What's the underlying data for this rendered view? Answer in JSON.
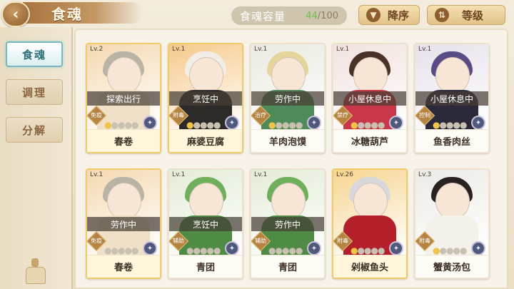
{
  "header": {
    "back_icon": "back-arrow-icon",
    "title": "食魂",
    "capacity_label": "食魂容量",
    "capacity_current": "44",
    "capacity_max": "/100",
    "sort_order_label": "降序",
    "sort_field_label": "等级"
  },
  "sidebar": {
    "tabs": [
      {
        "label": "食魂",
        "active": true
      },
      {
        "label": "调理",
        "active": false
      },
      {
        "label": "分解",
        "active": false
      }
    ]
  },
  "cards": [
    {
      "level": "Lv.2",
      "status": "探索出行",
      "role": "免疫",
      "name": "春卷",
      "stars": 1,
      "max_stars": 5,
      "rarity": "gold",
      "hair": "#b9b3a6",
      "outfit": "#f0e0c8",
      "bg": "#f5d9b2"
    },
    {
      "level": "Lv.1",
      "status": "烹饪中",
      "role": "附毒",
      "name": "麻婆豆腐",
      "stars": 1,
      "max_stars": 5,
      "rarity": "gold",
      "hair": "#f2ede6",
      "outfit": "#2d2a2a",
      "bg": "#f6c98a"
    },
    {
      "level": "Lv.1",
      "status": "劳作中",
      "role": "治疗",
      "name": "羊肉泡馍",
      "stars": 1,
      "max_stars": 5,
      "rarity": "normal",
      "hair": "#e6d59a",
      "outfit": "#4f8a5b",
      "bg": "#eaeae2"
    },
    {
      "level": "Lv.1",
      "status": "小屋休息中",
      "role": "禁疗",
      "name": "冰糖葫芦",
      "stars": 1,
      "max_stars": 5,
      "rarity": "normal",
      "hair": "#4a3228",
      "outfit": "#c9384a",
      "bg": "#f1e2df"
    },
    {
      "level": "Lv.1",
      "status": "小屋休息中",
      "role": "控制",
      "name": "鱼香肉丝",
      "stars": 1,
      "max_stars": 5,
      "rarity": "normal",
      "hair": "#5a4a86",
      "outfit": "#2b2a3a",
      "bg": "#e7e1ea"
    },
    {
      "level": "Lv.1",
      "status": "劳作中",
      "role": "免疫",
      "name": "春卷",
      "stars": 0,
      "max_stars": 5,
      "rarity": "gold",
      "hair": "#b9b3a6",
      "outfit": "#f0e0c8",
      "bg": "#f5d9b2"
    },
    {
      "level": "Lv.1",
      "status": "烹饪中",
      "role": "辅助",
      "name": "青团",
      "stars": 0,
      "max_stars": 5,
      "rarity": "normal",
      "hair": "#6fae5b",
      "outfit": "#4e8b45",
      "bg": "#e3ecd7"
    },
    {
      "level": "Lv.1",
      "status": "劳作中",
      "role": "辅助",
      "name": "青团",
      "stars": 0,
      "max_stars": 5,
      "rarity": "normal",
      "hair": "#6fae5b",
      "outfit": "#4e8b45",
      "bg": "#e3ecd7"
    },
    {
      "level": "Lv.26",
      "status": "",
      "role": "附毒",
      "name": "剁椒鱼头",
      "stars": 1,
      "max_stars": 5,
      "rarity": "gold",
      "hair": "#d8d8dc",
      "outfit": "#b3202b",
      "bg": "#f6d58f"
    },
    {
      "level": "Lv.3",
      "status": "",
      "role": "附毒",
      "name": "蟹黄汤包",
      "stars": 1,
      "max_stars": 5,
      "rarity": "normal",
      "hair": "#2a2220",
      "outfit": "#f4f0ea",
      "bg": "#ecebe6"
    }
  ],
  "colors": {
    "role_badge": "#b58443",
    "accent_green": "#6ec24e",
    "tab_active": "#79b6bd"
  }
}
